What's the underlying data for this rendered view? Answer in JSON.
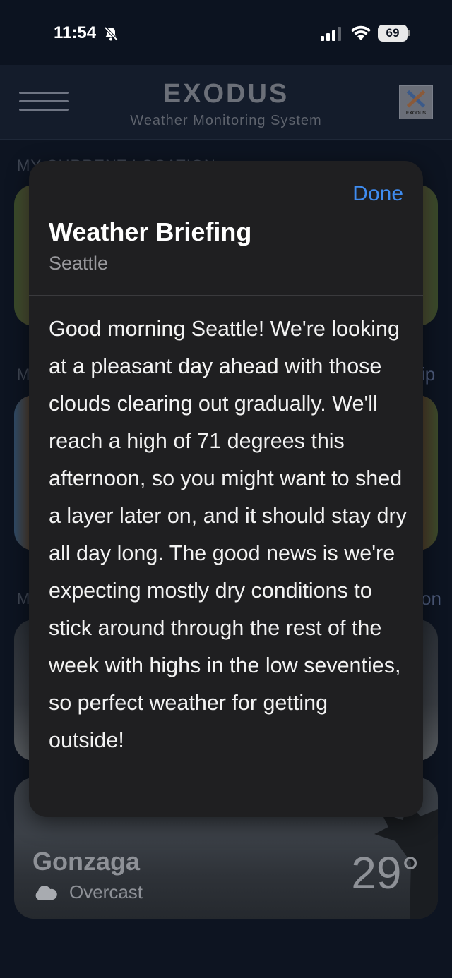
{
  "status_bar": {
    "time": "11:54",
    "battery": "69"
  },
  "header": {
    "title": "EXODUS",
    "subtitle": "Weather Monitoring System",
    "logo_text": "EXODUS"
  },
  "background": {
    "section_label": "MY CURRENT LOCATION",
    "partial_label_2": "M",
    "partial_label_3": "M",
    "edge_text_2": "ip",
    "edge_text_3": "on",
    "card": {
      "name": "Gonzaga",
      "condition": "Overcast",
      "temperature": "29°"
    }
  },
  "modal": {
    "done_label": "Done",
    "title": "Weather Briefing",
    "location": "Seattle",
    "briefing": "Good morning Seattle! We're looking at a pleasant day ahead with those clouds clearing out gradually. We'll reach a high of 71 degrees this afternoon, so you might want to shed a layer later on, and it should stay dry all day long. The good news is we're expecting mostly dry conditions to stick around through the rest of the week with highs in the low seventies, so perfect weather for getting outside!"
  },
  "colors": {
    "accent": "#3f8cf0",
    "modal_bg": "#1f1f21",
    "app_bg": "#0d1421"
  }
}
